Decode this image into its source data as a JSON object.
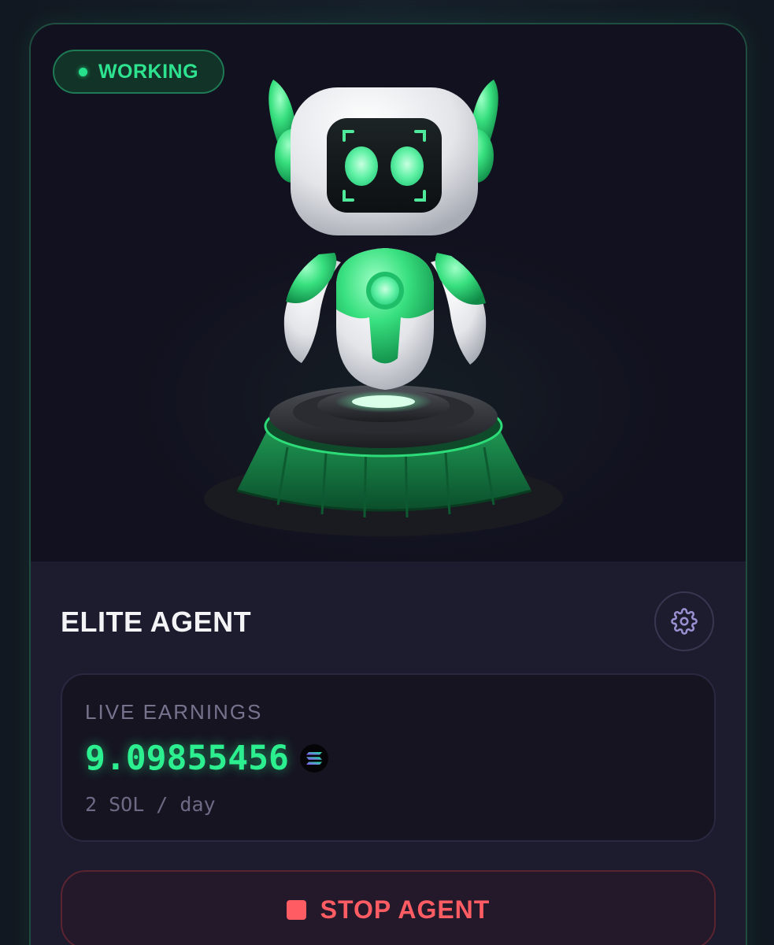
{
  "status": {
    "label": "WORKING",
    "color": "#2ee38f"
  },
  "agent": {
    "name": "ELITE AGENT",
    "illustration": "robot-on-pedestal"
  },
  "settings": {
    "icon": "gear-icon"
  },
  "earnings": {
    "label": "LIVE EARNINGS",
    "value": "9.09855456",
    "currency_icon": "solana-icon",
    "rate": "2 SOL / day",
    "accent_color": "#2cf08f"
  },
  "stop_button": {
    "label": "STOP AGENT",
    "icon": "stop-icon",
    "color": "#ff5c64"
  }
}
